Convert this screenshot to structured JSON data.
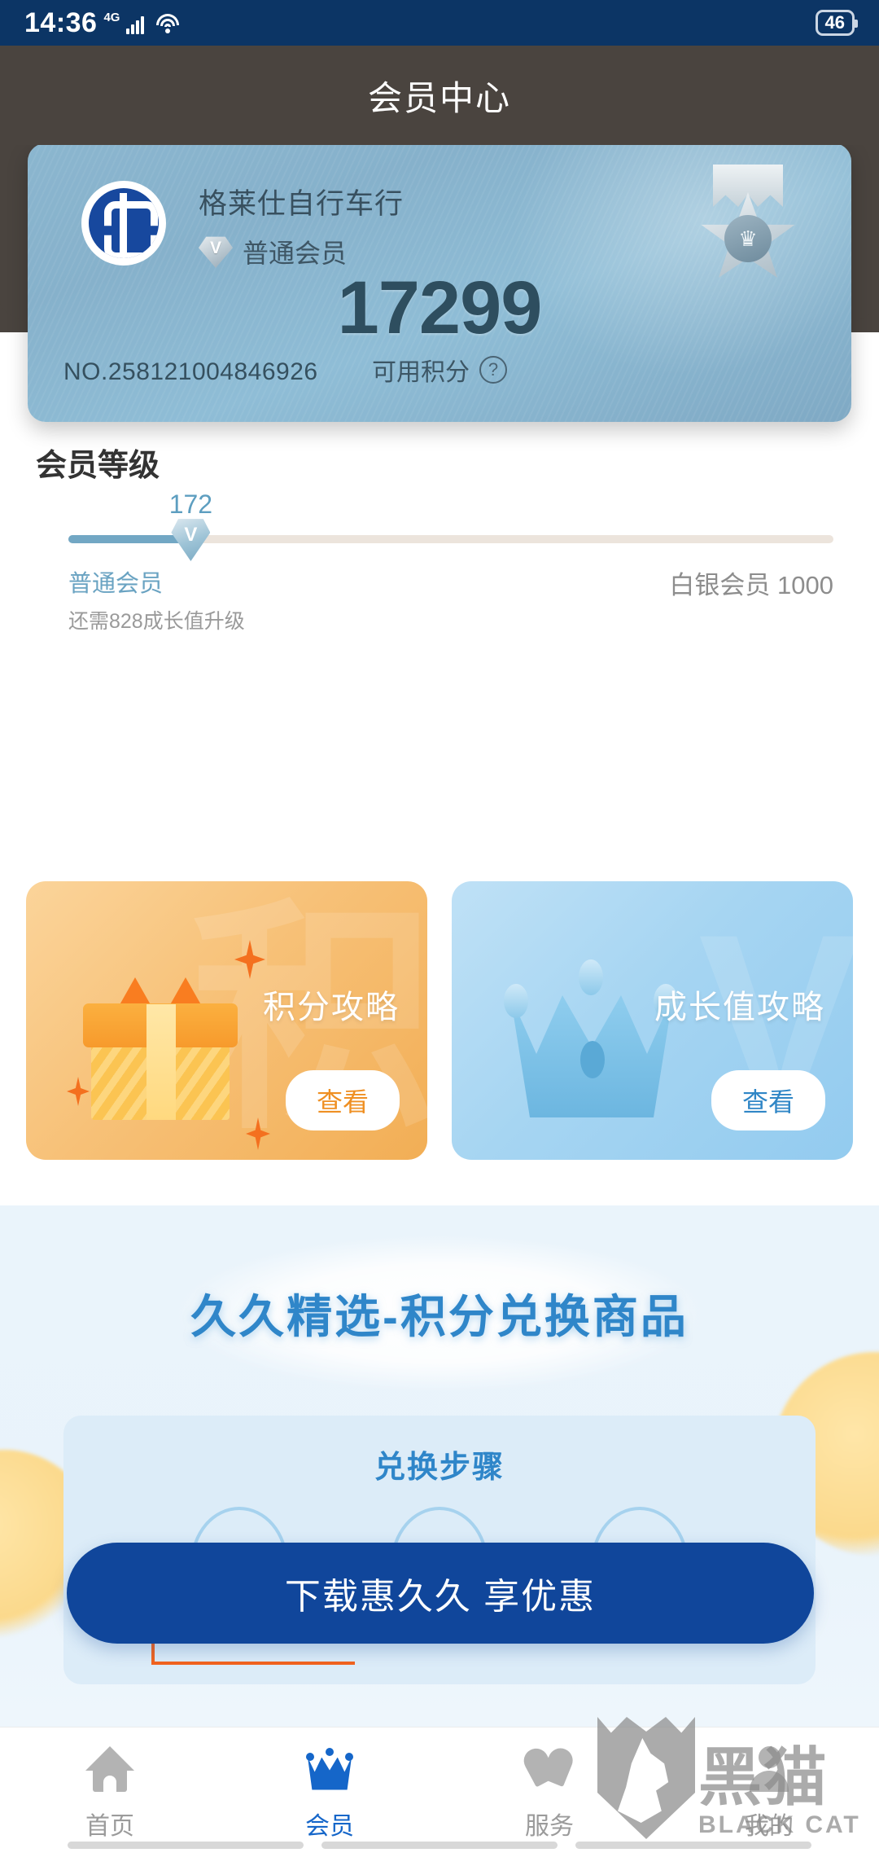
{
  "statusbar": {
    "time": "14:36",
    "network": "4G",
    "battery": "46",
    "wifi_icon": "wifi-icon",
    "signal_icon": "signal-bars-icon"
  },
  "header": {
    "title": "会员中心"
  },
  "member_card": {
    "shop_name": "格莱仕自行车行",
    "tier_badge_letter": "V",
    "tier_label": "普通会员",
    "points": "17299",
    "points_label": "可用积分",
    "help_icon": "question-mark-icon",
    "card_number": "NO.258121004846926",
    "medal_icon": "medal-icon",
    "logo_icon": "bank-logo-icon",
    "card_color": "#86b1cb",
    "points_color": "#2e4e5f"
  },
  "level": {
    "section_title": "会员等级",
    "current_value": "172",
    "knob_letter": "V",
    "current_tier": "普通会员",
    "hint": "还需828成长值升级",
    "next_tier": "白银会员 1000",
    "progress_percent": 16,
    "track_color": "#ece4dc",
    "fill_color": "#72a7c4"
  },
  "promos": [
    {
      "title": "积分攻略",
      "button": "查看",
      "ghost_char": "积",
      "icon": "gift-box-icon",
      "accent": "#ef8f22"
    },
    {
      "title": "成长值攻略",
      "button": "查看",
      "ghost_char": "V",
      "icon": "crown-icon",
      "accent": "#2f86c6"
    }
  ],
  "blue_section": {
    "banner_title": "久久精选-积分兑换商品",
    "steps_title": "兑换步骤",
    "steps": [
      {
        "icon": "phone-icon"
      },
      {
        "icon": "tap-hand-icon"
      },
      {
        "icon": "coins-icon"
      }
    ],
    "accent": "#2f86c9"
  },
  "cta": {
    "label": "下载惠久久 享优惠",
    "color": "#10469b"
  },
  "tabbar": {
    "items": [
      {
        "label": "首页",
        "icon": "home-icon",
        "active": false
      },
      {
        "label": "会员",
        "icon": "crown-icon",
        "active": true
      },
      {
        "label": "服务",
        "icon": "heart-icon",
        "active": false
      },
      {
        "label": "我的",
        "icon": "user-icon",
        "active": false
      }
    ],
    "active_color": "#1566c9",
    "inactive_color": "#9b9b9b"
  },
  "watermark": {
    "cn": "黑猫",
    "en": "BLACK CAT",
    "icon": "black-cat-shield-icon"
  }
}
